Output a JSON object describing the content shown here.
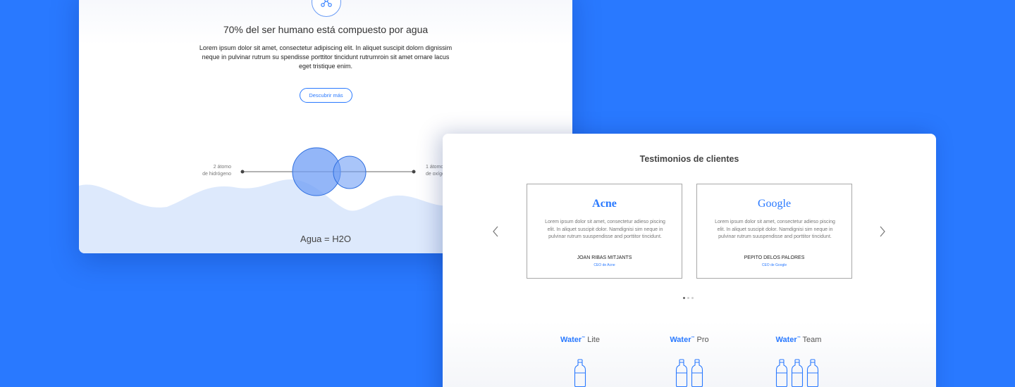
{
  "panel_left": {
    "title": "70% del ser humano está compuesto por agua",
    "body": "Lorem ipsum dolor sit amet, consectetur adipiscing elit. In aliquet suscipit dolorn dignissim neque in pulvinar rutrum su spendisse porttitor tincidunt rutrumroin sit amet ornare lacus eget tristique enim.",
    "button_label": "Descubrir más",
    "hydrogen_line1": "2 átomo",
    "hydrogen_line2": "de hidrógeno",
    "oxygen_line1": "1 átomo",
    "oxygen_line2": "de oxígeno",
    "formula": "Agua = H2O"
  },
  "panel_right": {
    "title": "Testimonios de clientes",
    "testimonials": [
      {
        "brand": "Acne",
        "quote": "Lorem ipsum dolor sit amet, consectetur adieso piscing elit. In aliquet suscipit dolor. Namdignisi sim neque in pulvinar rutrum suuspendisse and porttitor tincidunt.",
        "name": "JOAN RIBAS MITJANTS",
        "role": "CEO de Acne"
      },
      {
        "brand": "Google",
        "quote": "Lorem ipsum dolor sit amet, consectetur adieso piscing elit. In aliquet suscipit dolor. Namdignisi sim neque in pulvinar rutrum suuspendisse and porttitor tincidunt.",
        "name": "PEPITO DELOS PALORES",
        "role": "CEO de Google"
      }
    ],
    "carousel": {
      "pages": 3,
      "active_index": 0
    },
    "plans": [
      {
        "brand": "Water",
        "tm": "™",
        "tier": " Lite",
        "bottles": 1
      },
      {
        "brand": "Water",
        "tm": "™",
        "tier": " Pro",
        "bottles": 2
      },
      {
        "brand": "Water",
        "tm": "™",
        "tier": " Team",
        "bottles": 3
      }
    ]
  },
  "colors": {
    "background": "#2979ff",
    "accent": "#2979ff",
    "wave": "#dde9fc"
  },
  "icons": [
    "molecule-icon",
    "chevron-left-icon",
    "chevron-right-icon",
    "water-bottle-icon"
  ]
}
